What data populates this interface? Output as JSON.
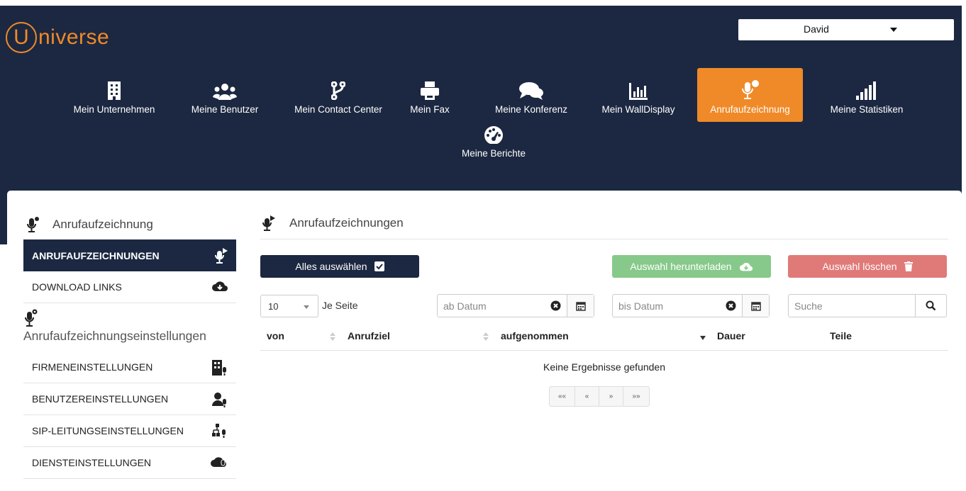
{
  "app": {
    "logo_letter": "U",
    "logo_text": "niverse",
    "brand_color": "#f08a28",
    "nav_bg": "#1c2841"
  },
  "user": {
    "name": "David"
  },
  "nav": {
    "items": [
      {
        "label": "Mein Unternehmen",
        "icon": "building-icon"
      },
      {
        "label": "Meine Benutzer",
        "icon": "users-icon"
      },
      {
        "label": "Mein Contact Center",
        "icon": "branch-icon"
      },
      {
        "label": "Mein Fax",
        "icon": "printer-icon"
      },
      {
        "label": "Meine Konferenz",
        "icon": "comments-icon"
      },
      {
        "label": "Mein WallDisplay",
        "icon": "bar-chart-icon"
      },
      {
        "label": "Anrufaufzeichnung",
        "icon": "microphone-icon",
        "active": true
      },
      {
        "label": "Meine Statistiken",
        "icon": "signal-icon"
      },
      {
        "label": "Meine Berichte",
        "icon": "dashboard-icon"
      }
    ]
  },
  "sidebar": {
    "title": "Anrufaufzeichnung",
    "items": [
      {
        "label": "ANRUFAUFZEICHNUNGEN",
        "icon": "microphone-play-icon",
        "active": true
      },
      {
        "label": "DOWNLOAD LINKS",
        "icon": "cloud-download-icon"
      }
    ],
    "settings_title": "Anrufaufzeichnungseinstellungen",
    "settings": [
      {
        "label": "FIRMENEINSTELLUNGEN",
        "icon": "building-mic-icon"
      },
      {
        "label": "BENUTZEREINSTELLUNGEN",
        "icon": "user-mic-icon"
      },
      {
        "label": "SIP-LEITUNGSEINSTELLUNGEN",
        "icon": "sitemap-mic-icon"
      },
      {
        "label": "DIENSTEINSTELLUNGEN",
        "icon": "cloud-mic-icon"
      }
    ]
  },
  "main": {
    "title": "Anrufaufzeichnungen",
    "buttons": {
      "select_all": "Alles auswählen",
      "download": "Auswahl herunterladen",
      "delete": "Auswahl löschen"
    },
    "per_page": {
      "value": "10",
      "label": "Je Seite"
    },
    "from_date": {
      "placeholder": "ab Datum"
    },
    "to_date": {
      "placeholder": "bis Datum"
    },
    "search": {
      "placeholder": "Suche"
    },
    "columns": [
      "von",
      "Anrufziel",
      "aufgenommen",
      "Dauer",
      "Teile"
    ],
    "empty_text": "Keine Ergebnisse gefunden",
    "pager": [
      "««",
      "«",
      "»",
      "»»"
    ]
  }
}
